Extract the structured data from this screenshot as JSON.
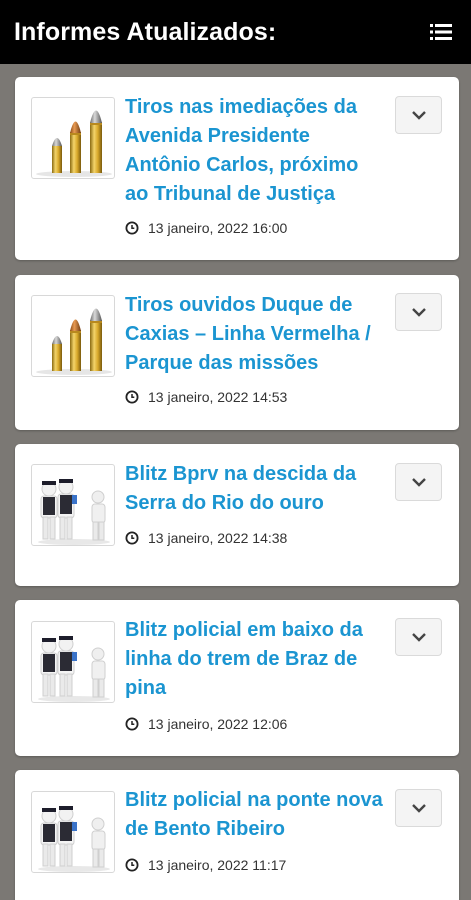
{
  "header": {
    "title": "Informes Atualizados:",
    "menu_icon": "list-menu-icon"
  },
  "colors": {
    "header_bg": "#000000",
    "page_bg": "#7b7874",
    "headline": "#1b95d1"
  },
  "reports": [
    {
      "headline": "Tiros nas imediações da Avenida Presidente Antônio Carlos, próximo ao Tribunal de Justiça",
      "datetime": "13 janeiro, 2022 16:00",
      "thumb_icon": "bullets-icon"
    },
    {
      "headline": "Tiros ouvidos Duque de Caxias – Linha Vermelha / Parque das missões",
      "datetime": "13 janeiro, 2022 14:53",
      "thumb_icon": "bullets-icon"
    },
    {
      "headline": "Blitz Bprv na descida da Serra do Rio do ouro",
      "datetime": "13 janeiro, 2022 14:38",
      "thumb_icon": "police-blitz-icon"
    },
    {
      "headline": "Blitz policial em baixo da linha do trem de Braz de pina",
      "datetime": "13 janeiro, 2022 12:06",
      "thumb_icon": "police-blitz-icon"
    },
    {
      "headline": "Blitz policial na ponte nova de Bento Ribeiro",
      "datetime": "13 janeiro, 2022 11:17",
      "thumb_icon": "police-blitz-icon"
    }
  ]
}
